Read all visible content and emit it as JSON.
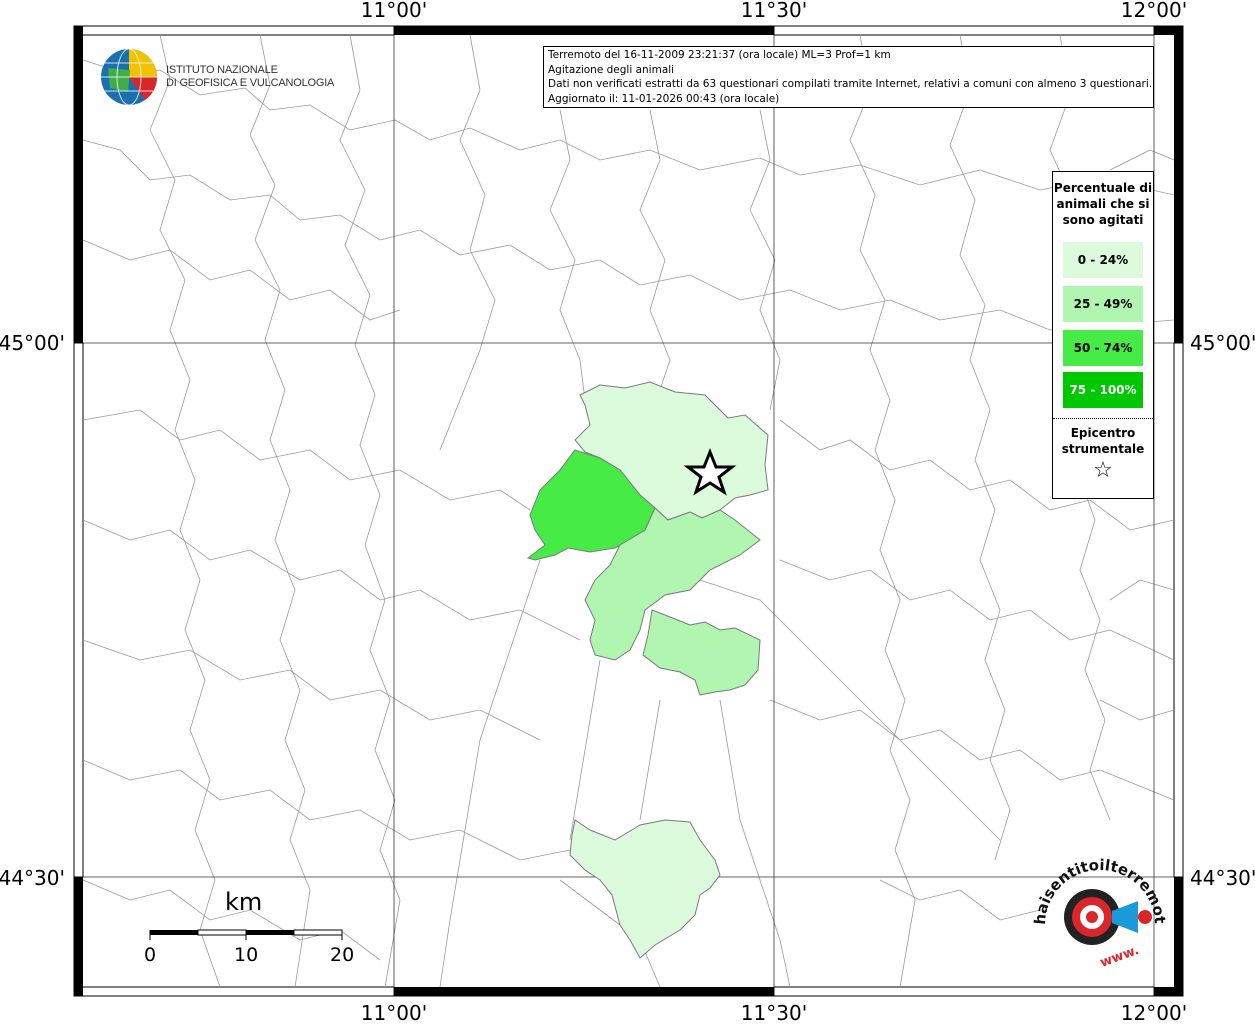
{
  "info": {
    "line1": "Terremoto del 16-11-2009 23:21:37 (ora locale) ML=3 Prof=1 km",
    "line2": "Agitazione degli animali",
    "line3": "Dati non verificati estratti da 63 questionari compilati tramite Internet, relativi a comuni con almeno 3 questionari.",
    "line4": "Aggiornato il: 11-01-2026 00:43 (ora locale)"
  },
  "axes": {
    "lon_top": [
      "11°00'",
      "11°30'",
      "12°00'"
    ],
    "lon_bottom": [
      "11°00'",
      "11°30'",
      "12°00'"
    ],
    "lat_left": [
      "45°00'",
      "44°30'"
    ],
    "lat_right": [
      "45°00'",
      "44°30'"
    ]
  },
  "legend": {
    "title": "Percentuale di animali che si sono agitati",
    "classes": [
      {
        "label": "0 - 24%",
        "color": "#dcfadc"
      },
      {
        "label": "25 - 49%",
        "color": "#b0f5b0"
      },
      {
        "label": "50 - 74%",
        "color": "#46eb46"
      },
      {
        "label": "75 - 100%",
        "color": "#00c800"
      }
    ],
    "epicenter_label": "Epicentro strumentale",
    "epicenter_symbol": "☆"
  },
  "logo": {
    "line1": "ISTITUTO NAZIONALE",
    "line2": "DI GEOFISICA E VULCANOLOGIA"
  },
  "scale_bar": {
    "unit": "km",
    "ticks": [
      "0",
      "10",
      "20"
    ]
  },
  "hsl_logo": {
    "text": "haisentitoilterremoto.it",
    "url_text": "www."
  },
  "colors": {
    "border": "#808080",
    "frame": "#000000",
    "lightest": "#dcfadc",
    "light": "#b0f5b0",
    "medium": "#46eb46"
  }
}
